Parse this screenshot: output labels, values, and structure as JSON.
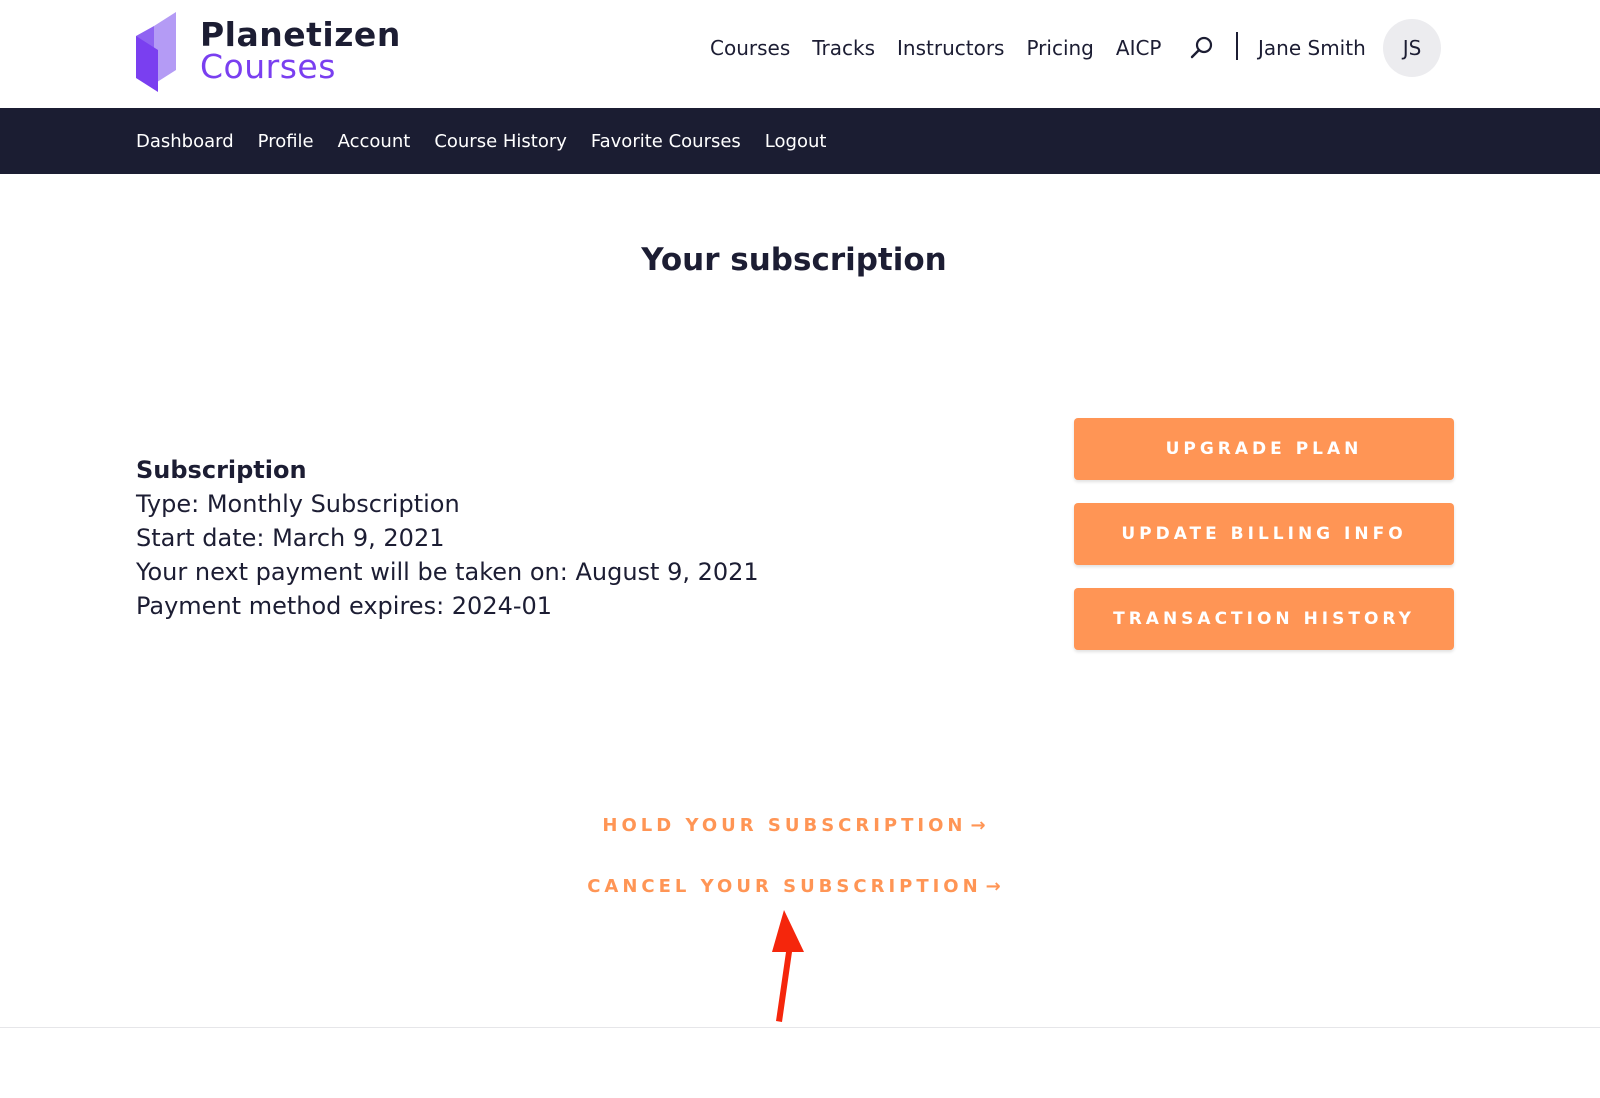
{
  "brand": {
    "line1": "Planetizen",
    "line2": "Courses",
    "logo_icon": "planetizen-book-logo",
    "colors": {
      "purple": "#7a3ff0",
      "lavender": "#b49bf5",
      "navy": "#1c1d33"
    }
  },
  "main_nav": {
    "items": [
      "Courses",
      "Tracks",
      "Instructors",
      "Pricing",
      "AICP"
    ],
    "search_icon": "search-icon"
  },
  "user": {
    "name": "Jane Smith",
    "initials": "JS"
  },
  "account_nav": {
    "items": [
      "Dashboard",
      "Profile",
      "Account",
      "Course History",
      "Favorite Courses",
      "Logout"
    ]
  },
  "page": {
    "title": "Your subscription"
  },
  "subscription": {
    "heading": "Subscription",
    "type": "Type: Monthly Subscription",
    "start_date": "Start date: March 9, 2021",
    "next_payment": "Your next payment will be taken on: August 9, 2021",
    "payment_expires": "Payment method expires: 2024-01"
  },
  "actions": {
    "upgrade": "UPGRADE PLAN",
    "update_billing": "UPDATE BILLING INFO",
    "transaction_history": "TRANSACTION HISTORY"
  },
  "links": {
    "hold": "HOLD YOUR SUBSCRIPTION",
    "cancel": "CANCEL YOUR SUBSCRIPTION",
    "arrow": "→"
  },
  "colors": {
    "accent": "#ff9555",
    "nav_bg": "#1b1d32",
    "annotation": "#f5260c"
  }
}
